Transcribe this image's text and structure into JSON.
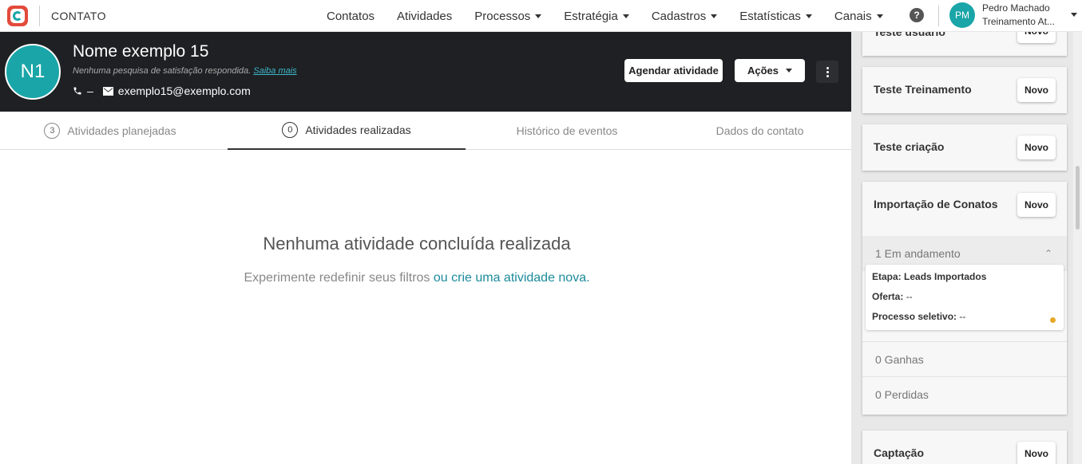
{
  "app": {
    "name": "CONTATO"
  },
  "nav": [
    {
      "label": "Contatos",
      "dropdown": false
    },
    {
      "label": "Atividades",
      "dropdown": false
    },
    {
      "label": "Processos",
      "dropdown": true
    },
    {
      "label": "Estratégia",
      "dropdown": true
    },
    {
      "label": "Cadastros",
      "dropdown": true
    },
    {
      "label": "Estatísticas",
      "dropdown": true
    },
    {
      "label": "Canais",
      "dropdown": true
    }
  ],
  "help_label": "?",
  "user": {
    "initials": "PM",
    "name": "Pedro Machado",
    "org": "Treinamento At..."
  },
  "contact": {
    "initials": "N1",
    "name": "Nome exemplo 15",
    "survey_text": "Nenhuma pesquisa de satisfação respondida.",
    "survey_link": "Saiba mais",
    "phone": "–",
    "email": "exemplo15@exemplo.com"
  },
  "actions": {
    "schedule": "Agendar atividade",
    "actions": "Ações"
  },
  "tabs": [
    {
      "count": "3",
      "label": "Atividades planejadas",
      "active": false
    },
    {
      "count": "0",
      "label": "Atividades realizadas",
      "active": true
    },
    {
      "count": "",
      "label": "Histórico de eventos",
      "active": false
    },
    {
      "count": "",
      "label": "Dados do contato",
      "active": false
    }
  ],
  "empty": {
    "title": "Nenhuma atividade concluída realizada",
    "subtitle": "Experimente redefinir seus filtros",
    "link": "ou crie uma atividade nova."
  },
  "side": {
    "new_label": "Novo",
    "cards": [
      {
        "title": "Teste usuário"
      },
      {
        "title": "Teste Treinamento"
      },
      {
        "title": "Teste criação"
      },
      {
        "title": "Importação de Conatos"
      },
      {
        "title": "Captação"
      }
    ],
    "in_progress": "1 Em andamento",
    "deal": {
      "stage_label": "Etapa:",
      "stage_value": "Leads Importados",
      "offer_label": "Oferta:",
      "offer_value": "--",
      "process_label": "Processo seletivo:",
      "process_value": "--"
    },
    "won": "0 Ganhas",
    "lost": "0 Perdidas"
  },
  "colors": {
    "teal": "#1aa5a8",
    "header_bg": "#1e2023",
    "link": "#1c8b9b",
    "status_dot": "#e5a92a"
  }
}
